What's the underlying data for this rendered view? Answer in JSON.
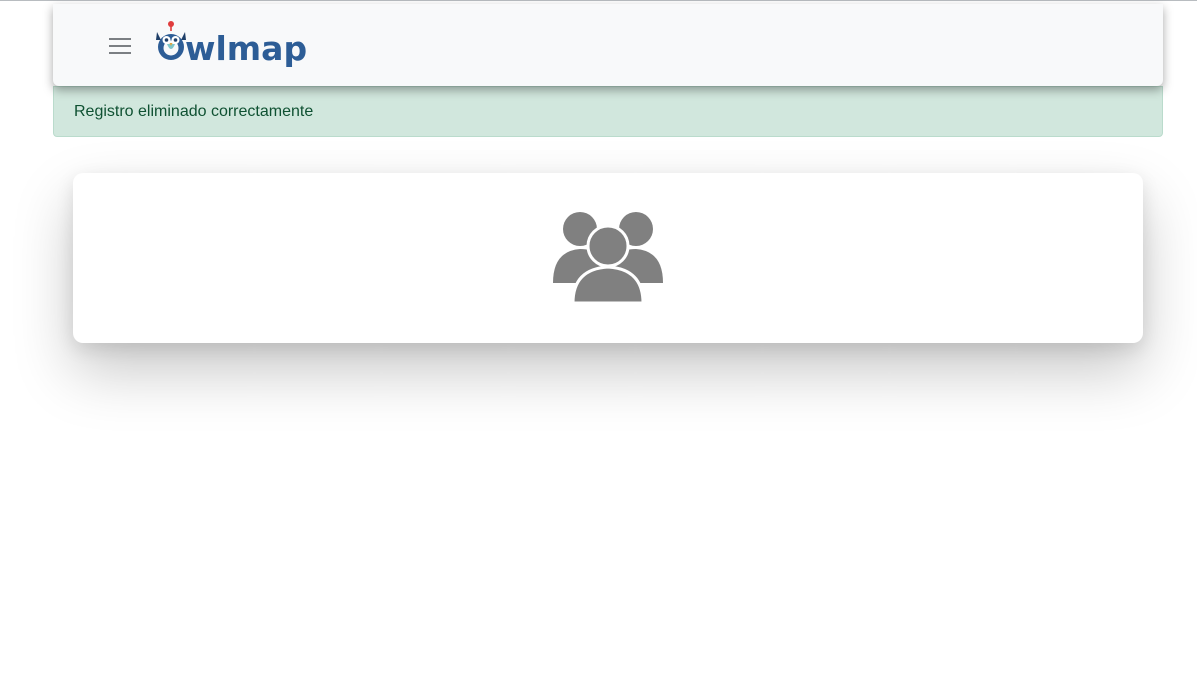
{
  "navbar": {
    "menu_icon": "hamburger-menu-icon",
    "logo_text": "Owlmap"
  },
  "alert": {
    "message": "Registro eliminado correctamente",
    "color": "#0f5132",
    "background": "#d1e7dd"
  },
  "card": {
    "icon": "users-group-icon",
    "icon_color": "#808080"
  },
  "colors": {
    "brand_blue": "#2d5d96",
    "navbar_bg": "#f8f9fa"
  }
}
